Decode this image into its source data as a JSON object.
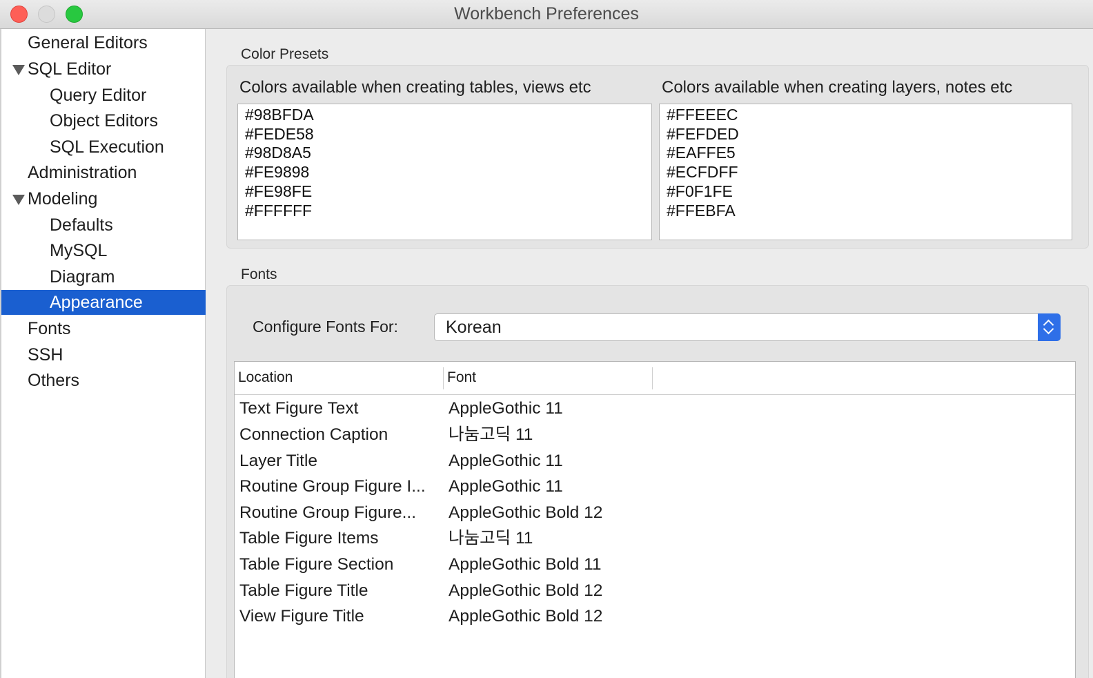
{
  "window": {
    "title": "Workbench Preferences"
  },
  "sidebar": {
    "items": [
      {
        "label": "General Editors"
      },
      {
        "label": "SQL Editor"
      },
      {
        "label": "Query Editor"
      },
      {
        "label": "Object Editors"
      },
      {
        "label": "SQL Execution"
      },
      {
        "label": "Administration"
      },
      {
        "label": "Modeling"
      },
      {
        "label": "Defaults"
      },
      {
        "label": "MySQL"
      },
      {
        "label": "Diagram"
      },
      {
        "label": "Appearance"
      },
      {
        "label": "Fonts"
      },
      {
        "label": "SSH"
      },
      {
        "label": "Others"
      }
    ],
    "selected": "Appearance"
  },
  "color_presets": {
    "title": "Color Presets",
    "tables_label": "Colors available when creating tables, views etc",
    "tables_colors": [
      "#98BFDA",
      "#FEDE58",
      "#98D8A5",
      "#FE9898",
      "#FE98FE",
      "#FFFFFF"
    ],
    "layers_label": "Colors available when creating layers, notes etc",
    "layers_colors": [
      "#FFEEEC",
      "#FEFDED",
      "#EAFFE5",
      "#ECFDFF",
      "#F0F1FE",
      "#FFEBFA"
    ]
  },
  "fonts": {
    "title": "Fonts",
    "configure_label": "Configure Fonts For:",
    "configure_value": "Korean",
    "columns": [
      "Location",
      "Font"
    ],
    "rows": [
      {
        "location": "Text Figure Text",
        "font": "AppleGothic 11"
      },
      {
        "location": "Connection Caption",
        "font": "나눔고딕 11"
      },
      {
        "location": "Layer Title",
        "font": "AppleGothic 11"
      },
      {
        "location": "Routine Group Figure I...",
        "font": "AppleGothic 11"
      },
      {
        "location": "Routine Group Figure...",
        "font": "AppleGothic Bold 12"
      },
      {
        "location": "Table Figure Items",
        "font": "나눔고딕 11"
      },
      {
        "location": "Table Figure Section",
        "font": "AppleGothic Bold 11"
      },
      {
        "location": "Table Figure Title",
        "font": "AppleGothic Bold 12"
      },
      {
        "location": "View Figure Title",
        "font": "AppleGothic Bold 12"
      }
    ]
  },
  "colors": {
    "selection": "#1a5fd0",
    "select_button": "#2e6fe8",
    "close": "#fe5f57",
    "minimize": "#dcdcdc",
    "maximize": "#28c840"
  }
}
